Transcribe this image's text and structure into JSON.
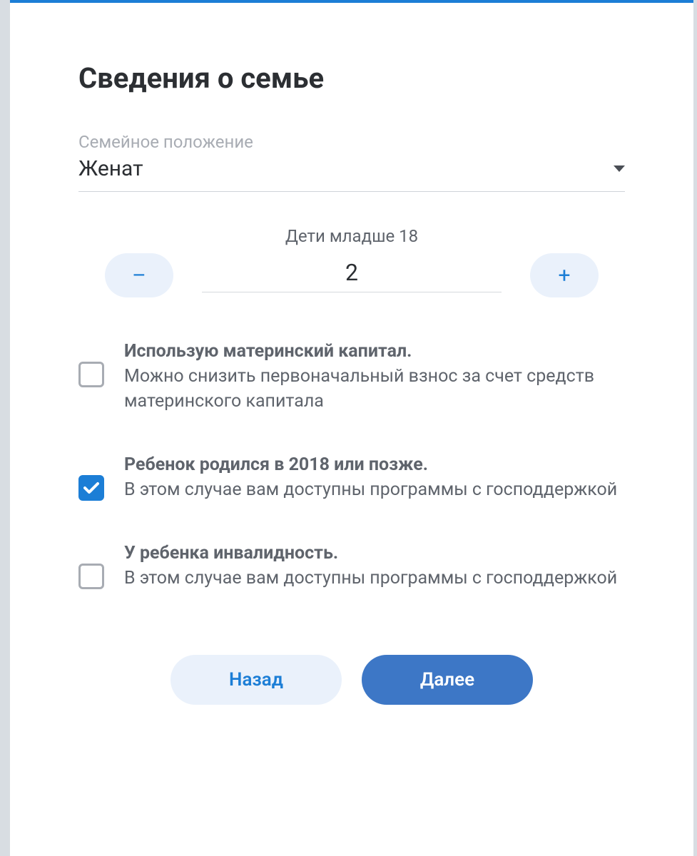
{
  "title": "Сведения о семье",
  "marital": {
    "label": "Семейное положение",
    "value": "Женат"
  },
  "children": {
    "label": "Дети младше 18",
    "value": "2",
    "minus": "–",
    "plus": "+"
  },
  "options": [
    {
      "title": "Использую материнский капитал.",
      "desc": "Можно снизить первоначальный взнос за счет средств материнского капитала",
      "checked": false
    },
    {
      "title": "Ребенок родился в 2018 или позже.",
      "desc": "В этом случае вам доступны программы с господдержкой",
      "checked": true
    },
    {
      "title": "У ребенка инвалидность.",
      "desc": "В этом случае вам доступны программы с господдержкой",
      "checked": false
    }
  ],
  "buttons": {
    "back": "Назад",
    "next": "Далее"
  }
}
